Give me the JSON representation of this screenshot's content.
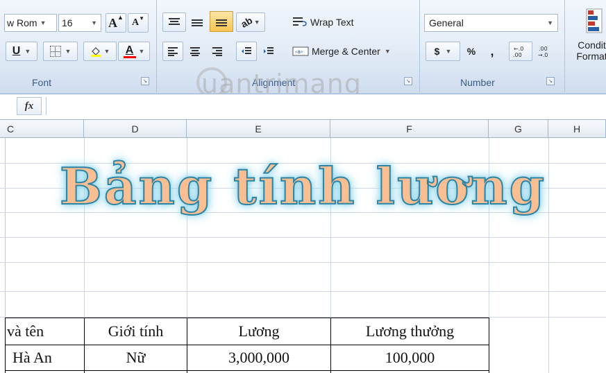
{
  "font_group": {
    "font_name": "w Rom",
    "font_size": "16",
    "label": "Font"
  },
  "alignment_group": {
    "wrap_text": "Wrap Text",
    "merge_center": "Merge & Center",
    "label": "Alignment"
  },
  "number_group": {
    "format": "General",
    "currency": "$",
    "percent": "%",
    "comma": ",",
    "label": "Number"
  },
  "styles_group": {
    "conditional_line1": "Condit",
    "conditional_line2": "Format"
  },
  "formula_bar": {
    "fx": "fx",
    "value": ""
  },
  "columns": [
    "C",
    "D",
    "E",
    "F",
    "G",
    "H"
  ],
  "sheet": {
    "title": "Bảng tính lương",
    "headers": [
      "và tên",
      "Giới tính",
      "Lương",
      "Lương thưởng"
    ],
    "row1": [
      "Hà An",
      "Nữ",
      "3,000,000",
      "100,000"
    ]
  },
  "watermark": "uantrimang",
  "colors": {
    "title_fill": "#f9be92",
    "title_outline": "#2c84a6",
    "ribbon_bg": "#dde8f5",
    "highlight_yellow": "#ffff00",
    "font_red": "#ff0000"
  }
}
